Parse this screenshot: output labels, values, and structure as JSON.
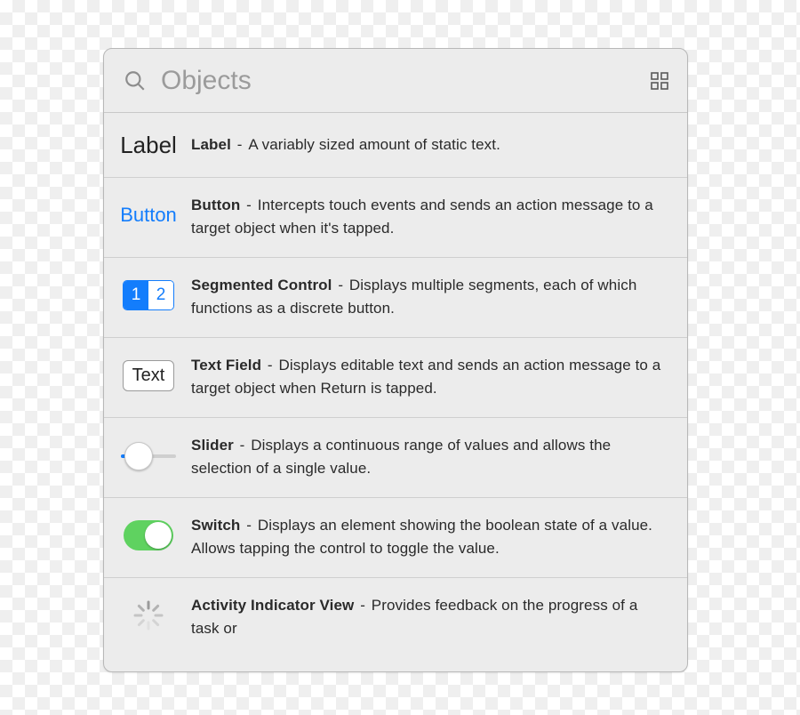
{
  "search": {
    "placeholder": "Objects",
    "value": ""
  },
  "thumb_text": {
    "label": "Label",
    "button": "Button",
    "seg_on": "1",
    "seg_off": "2",
    "textfield": "Text"
  },
  "items": [
    {
      "name": "Label",
      "desc": "A variably sized amount of static text."
    },
    {
      "name": "Button",
      "desc": "Intercepts touch events and sends an action message to a target object when it's tapped."
    },
    {
      "name": "Segmented Control",
      "desc": "Displays multiple segments, each of which functions as a discrete button."
    },
    {
      "name": "Text Field",
      "desc": "Displays editable text and sends an action message to a target object when Return is tapped."
    },
    {
      "name": "Slider",
      "desc": "Displays a continuous range of values and allows the selection of a single value."
    },
    {
      "name": "Switch",
      "desc": "Displays an element showing the boolean state of a value. Allows tapping the control to toggle the value."
    },
    {
      "name": "Activity Indicator View",
      "desc": "Provides feedback on the progress of a task or"
    }
  ]
}
